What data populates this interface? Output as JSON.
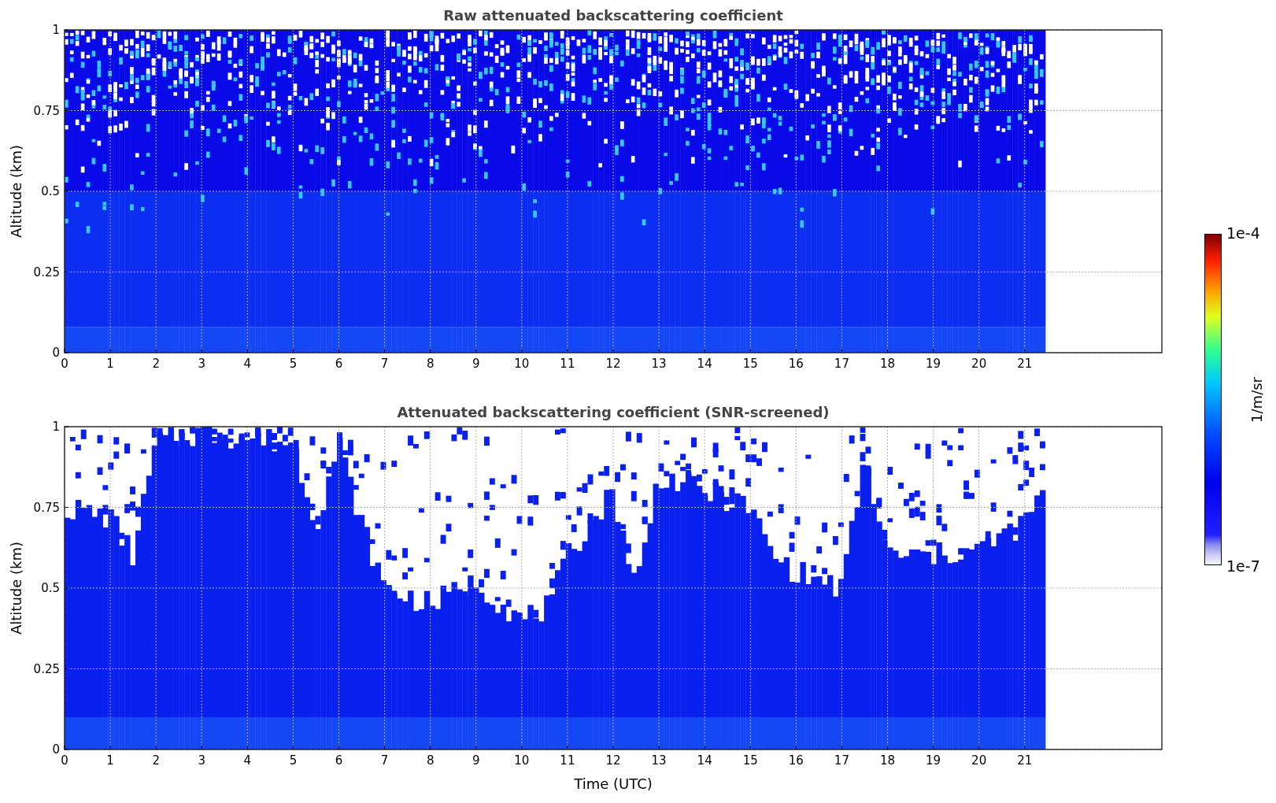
{
  "figure": {
    "panels": [
      {
        "kind": "raw",
        "title": "Raw attenuated backscattering coefficient",
        "ylabel": "Altitude (km)",
        "yticks": [
          "1",
          "0.75",
          "0.5",
          "0.25",
          "0"
        ],
        "xticks": [
          "0",
          "1",
          "2",
          "3",
          "4",
          "5",
          "6",
          "7",
          "8",
          "9",
          "10",
          "11",
          "12",
          "13",
          "14",
          "15",
          "16",
          "17",
          "18",
          "19",
          "20",
          "21"
        ]
      },
      {
        "kind": "screened",
        "title": "Attenuated backscattering coefficient (SNR-screened)",
        "ylabel": "Altitude (km)",
        "yticks": [
          "1",
          "0.75",
          "0.5",
          "0.25",
          "0"
        ],
        "xticks": [
          "0",
          "1",
          "2",
          "3",
          "4",
          "5",
          "6",
          "7",
          "8",
          "9",
          "10",
          "11",
          "12",
          "13",
          "14",
          "15",
          "16",
          "17",
          "18",
          "19",
          "20",
          "21"
        ],
        "xlabel": "Time (UTC)"
      }
    ],
    "colorbar": {
      "label": "1/m/sr",
      "max_label": "1e-4",
      "min_label": "1e-7"
    }
  }
}
